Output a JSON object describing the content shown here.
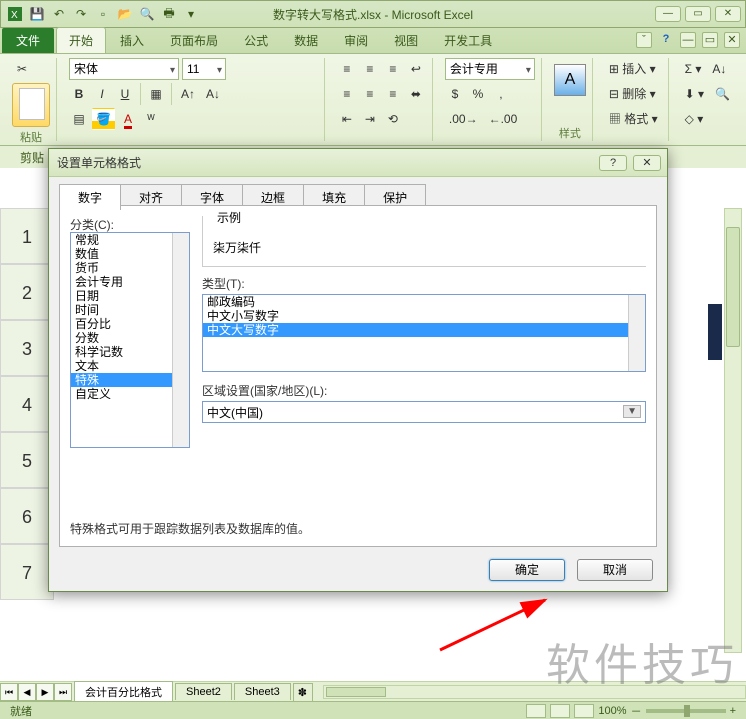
{
  "title": "数字转大写格式.xlsx - Microsoft Excel",
  "tabs": {
    "file": "文件",
    "t0": "开始",
    "t1": "插入",
    "t2": "页面布局",
    "t3": "公式",
    "t4": "数据",
    "t5": "审阅",
    "t6": "视图",
    "t7": "开发工具"
  },
  "ribbon": {
    "paste": "粘贴",
    "clipboard_cut": "剪贴",
    "font_name": "宋体",
    "font_size": "11",
    "number_format": "会计专用",
    "styles": "样式",
    "insert": "插入",
    "delete": "删除",
    "format": "格式"
  },
  "dialog": {
    "title": "设置单元格格式",
    "tabs": {
      "t0": "数字",
      "t1": "对齐",
      "t2": "字体",
      "t3": "边框",
      "t4": "填充",
      "t5": "保护"
    },
    "category_label": "分类(C):",
    "categories": [
      "常规",
      "数值",
      "货币",
      "会计专用",
      "日期",
      "时间",
      "百分比",
      "分数",
      "科学记数",
      "文本",
      "特殊",
      "自定义"
    ],
    "selected_category_index": 10,
    "example_label": "示例",
    "example_value": "柒万柒仟",
    "type_label": "类型(T):",
    "types": [
      "邮政编码",
      "中文小写数字",
      "中文大写数字"
    ],
    "selected_type_index": 2,
    "locale_label": "区域设置(国家/地区)(L):",
    "locale_value": "中文(中国)",
    "description": "特殊格式可用于跟踪数据列表及数据库的值。",
    "ok": "确定",
    "cancel": "取消"
  },
  "sheets": {
    "s0": "会计百分比格式",
    "s1": "Sheet2",
    "s2": "Sheet3"
  },
  "status": {
    "ready": "就绪",
    "zoom": "100%",
    "zoom_out": "－",
    "zoom_in": "+"
  },
  "rows": [
    "1",
    "2",
    "3",
    "4",
    "5",
    "6",
    "7"
  ],
  "watermark": "软件技巧",
  "chart_data": null
}
